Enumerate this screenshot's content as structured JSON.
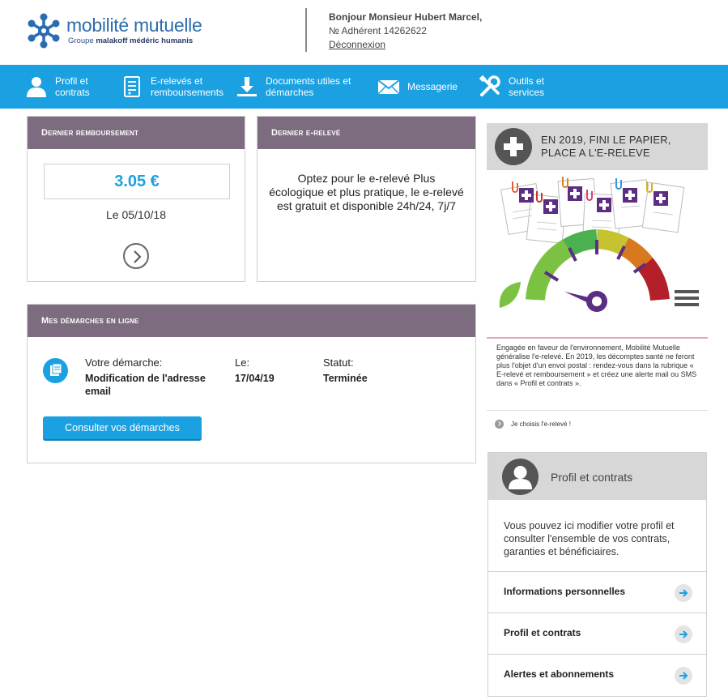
{
  "brand": {
    "name": "mobilité mutuelle",
    "group_prefix": "Groupe ",
    "group_name": "malakoff médéric humanis"
  },
  "user": {
    "greeting": "Bonjour Monsieur Hubert Marcel,",
    "member_number": "№ Adhérent 14262622",
    "logout": "Déconnexion"
  },
  "nav": {
    "profil": "Profil et contrats",
    "ereleves": "E-relevés et remboursements",
    "documents": "Documents utiles et démarches",
    "messagerie": "Messagerie",
    "outils": "Outils et services"
  },
  "remboursement": {
    "title": "Dernier remboursement",
    "amount": "3.05 €",
    "date": "Le 05/10/18"
  },
  "ereleve": {
    "title": "Dernier e-relevé",
    "text": "Optez pour le e-relevé Plus écologique et plus pratique, le e-relevé est gratuit et disponible 24h/24, 7j/7"
  },
  "demarches": {
    "title": "Mes démarches en ligne",
    "label_demarche": "Votre démarche:",
    "label_date": "Le:",
    "label_status": "Statut:",
    "demarche": "Modification de l'adresse email",
    "date": "17/04/19",
    "status": "Terminée",
    "button": "Consulter vos démarches"
  },
  "promo": {
    "title_line1": "EN 2019, FINI LE PAPIER,",
    "title_line2": "PLACE A L'E-RELEVE",
    "text": "Engagée en faveur de l'environnement, Mobilité Mutuelle généralise l'e-relevé. En 2019, les décomptes santé ne feront plus l'objet d'un envoi postal : rendez-vous dans la rubrique « E-relevé et remboursement » et créez une alerte mail ou SMS dans « Profil et contrats ».",
    "link": "Je choisis l'e-relevé !"
  },
  "profil": {
    "title": "Profil et contrats",
    "description": "Vous pouvez ici modifier votre profil et consulter l'ensemble de vos contrats, garanties et bénéficiaires.",
    "links": [
      "Informations personnelles",
      "Profil et contrats",
      "Alertes et abonnements"
    ]
  },
  "colors": {
    "primary_blue": "#1ba1e2",
    "header_purple": "#7d6c7f",
    "gauge_purple": "#5b2d83"
  },
  "icons": [
    "user-icon",
    "document-icon",
    "download-icon",
    "mail-icon",
    "tools-icon",
    "chevron-right-icon",
    "folder-icon",
    "plus-icon",
    "arrow-right-icon",
    "menu-icon"
  ]
}
